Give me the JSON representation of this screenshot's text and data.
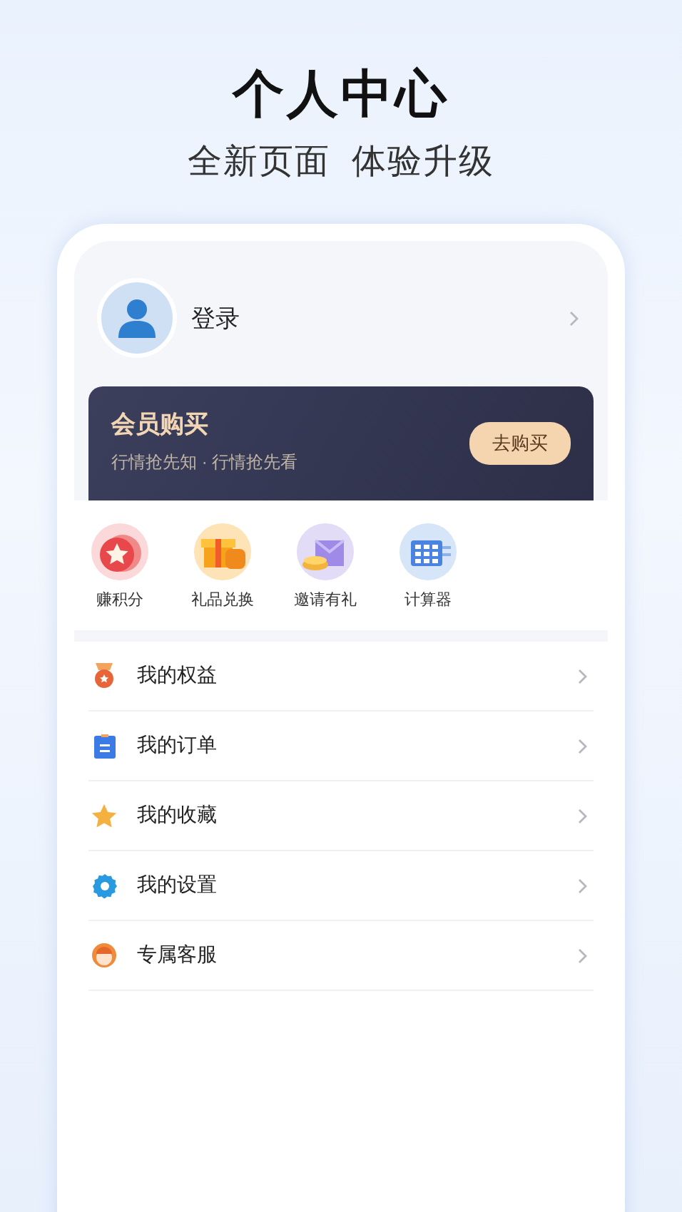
{
  "header": {
    "title": "个人中心",
    "subtitle": "全新页面  体验升级"
  },
  "profile": {
    "name": "登录"
  },
  "membership": {
    "title": "会员购买",
    "subtitle": "行情抢先知 · 行情抢先看",
    "button": "去购买"
  },
  "shortcuts": [
    {
      "kind": "points",
      "label": "赚积分"
    },
    {
      "kind": "gift",
      "label": "礼品兑换"
    },
    {
      "kind": "invite",
      "label": "邀请有礼"
    },
    {
      "kind": "calculator",
      "label": "计算器"
    }
  ],
  "menu": [
    {
      "kind": "medal",
      "label": "我的权益"
    },
    {
      "kind": "order",
      "label": "我的订单"
    },
    {
      "kind": "star",
      "label": "我的收藏"
    },
    {
      "kind": "settings",
      "label": "我的设置"
    },
    {
      "kind": "service",
      "label": "专属客服"
    }
  ]
}
